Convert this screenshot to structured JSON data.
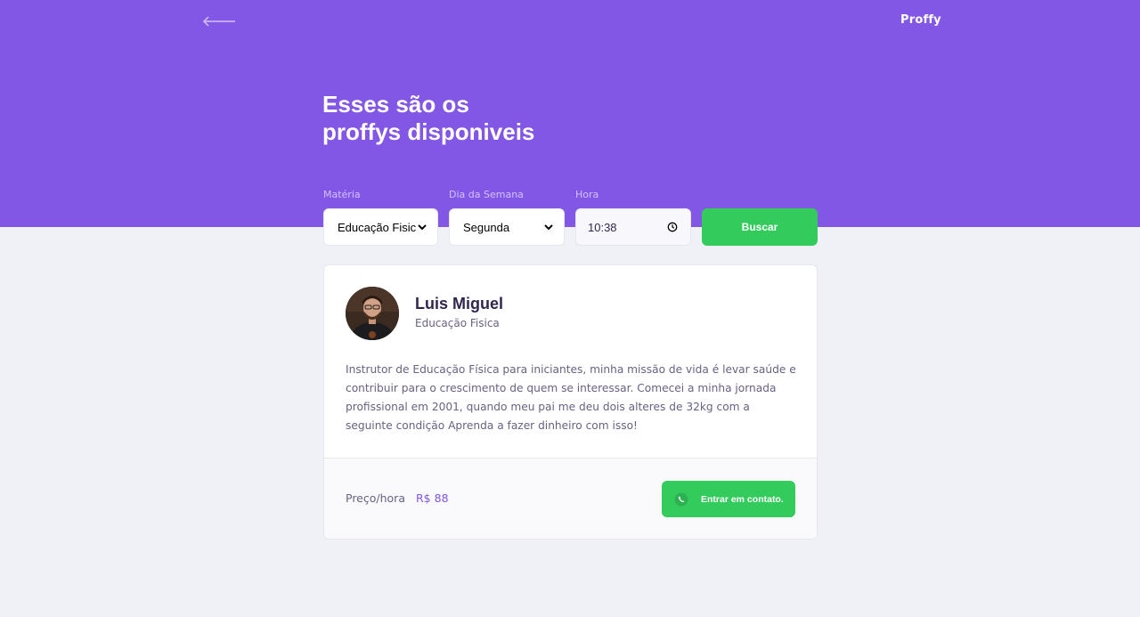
{
  "header": {
    "logo": "Proffy",
    "title_line1": "Esses são os",
    "title_line2": "proffys disponiveis",
    "back_icon": "arrow-left-icon"
  },
  "filters": {
    "subject_label": "Matéria",
    "subject_value": "Educação Fisica",
    "weekday_label": "Dia da Semana",
    "weekday_value": "Segunda",
    "time_label": "Hora",
    "time_value": "10:38",
    "search_label": "Buscar"
  },
  "teacher": {
    "name": "Luis Miguel",
    "subject": "Educação Fisica",
    "bio": "Instrutor de Educação Física para iniciantes, minha missão de vida é levar saúde e contribuir para o crescimento de quem se interessar. Comecei a minha jornada profissional em 2001, quando meu pai me deu dois alteres de 32kg com a seguinte condição Aprenda a fazer dinheiro com isso!",
    "price_label": "Preço/hora",
    "price_value": "R$ 88",
    "contact_label": "Entrar em contato.",
    "contact_icon": "whatsapp-icon"
  },
  "colors": {
    "primary": "#8257E5",
    "background": "#F0F0F7",
    "success": "#34CB5D",
    "title_text": "#32264D",
    "body_text": "#6A6180"
  }
}
